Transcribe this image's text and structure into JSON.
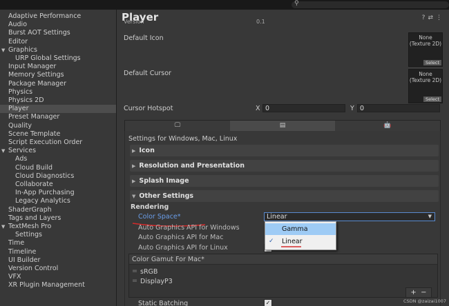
{
  "sidebar": {
    "items": [
      {
        "label": "Adaptive Performance"
      },
      {
        "label": "Audio"
      },
      {
        "label": "Burst AOT Settings"
      },
      {
        "label": "Editor"
      },
      {
        "label": "Graphics",
        "expanded": true
      },
      {
        "label": "URP Global Settings",
        "child": true
      },
      {
        "label": "Input Manager"
      },
      {
        "label": "Memory Settings"
      },
      {
        "label": "Package Manager"
      },
      {
        "label": "Physics"
      },
      {
        "label": "Physics 2D"
      },
      {
        "label": "Player",
        "selected": true
      },
      {
        "label": "Preset Manager"
      },
      {
        "label": "Quality"
      },
      {
        "label": "Scene Template"
      },
      {
        "label": "Script Execution Order"
      },
      {
        "label": "Services",
        "expanded": true
      },
      {
        "label": "Ads",
        "child": true
      },
      {
        "label": "Cloud Build",
        "child": true
      },
      {
        "label": "Cloud Diagnostics",
        "child": true
      },
      {
        "label": "Collaborate",
        "child": true
      },
      {
        "label": "In-App Purchasing",
        "child": true
      },
      {
        "label": "Legacy Analytics",
        "child": true
      },
      {
        "label": "ShaderGraph"
      },
      {
        "label": "Tags and Layers"
      },
      {
        "label": "TextMesh Pro",
        "expanded": true
      },
      {
        "label": "Settings",
        "child": true
      },
      {
        "label": "Time"
      },
      {
        "label": "Timeline"
      },
      {
        "label": "UI Builder"
      },
      {
        "label": "Version Control"
      },
      {
        "label": "VFX"
      },
      {
        "label": "XR Plugin Management"
      }
    ]
  },
  "main": {
    "title": "Player",
    "version_label": "Version",
    "version_value": "0.1",
    "default_icon_label": "Default Icon",
    "default_icon_thumb": "None\n(Texture 2D)",
    "default_icon_select": "Select",
    "default_cursor_label": "Default Cursor",
    "default_cursor_thumb": "None\n(Texture 2D)",
    "default_cursor_select": "Select",
    "cursor_hotspot_label": "Cursor Hotspot",
    "hotspot_x_label": "X",
    "hotspot_x_value": "0",
    "hotspot_y_label": "Y",
    "hotspot_y_value": "0",
    "tabs": [
      {
        "icon": "monitor-icon",
        "glyph": "🖵"
      },
      {
        "icon": "server-icon",
        "glyph": "▤"
      },
      {
        "icon": "android-icon",
        "glyph": "🤖"
      }
    ],
    "settings_for": "Settings for Windows, Mac, Linux",
    "sections": {
      "icon": "Icon",
      "resolution": "Resolution and Presentation",
      "splash": "Splash Image",
      "other": "Other Settings"
    },
    "rendering_label": "Rendering",
    "color_space_label": "Color Space*",
    "color_space_value": "Linear",
    "color_space_options": [
      {
        "label": "Gamma",
        "highlighted": true,
        "checked": false
      },
      {
        "label": "Linear",
        "highlighted": false,
        "checked": true
      }
    ],
    "auto_api_windows": "Auto Graphics API  for Windows",
    "auto_api_mac": "Auto Graphics API  for Mac",
    "auto_api_linux": "Auto Graphics API  for Linux",
    "color_gamut_header": "Color Gamut For Mac*",
    "color_gamut_items": [
      "sRGB",
      "DisplayP3"
    ],
    "plus": "+",
    "minus": "−",
    "static_batching_label": "Static Batching"
  },
  "header_icons": {
    "help": "?",
    "settings": "⇄",
    "more": "⋮"
  },
  "watermark": "CSDN @zaizai1007",
  "colors": {
    "accent": "#5a8bd0",
    "link_blue": "#6a9eea",
    "red_mark": "#d62a2a"
  }
}
